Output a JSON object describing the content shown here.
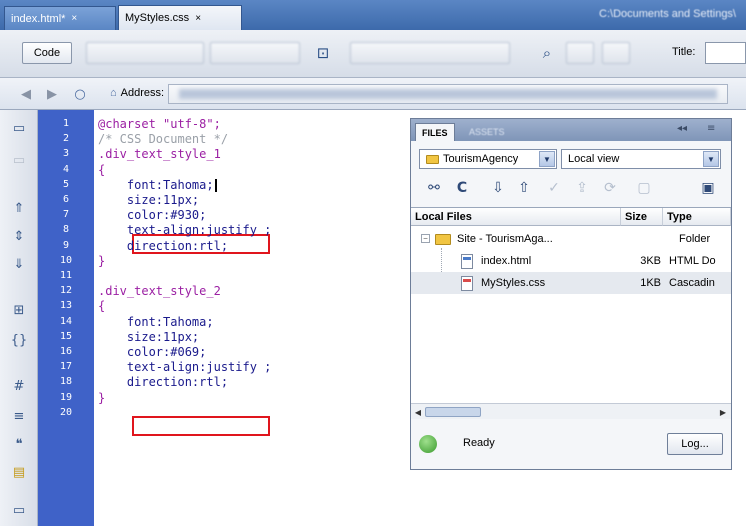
{
  "tabs": [
    {
      "label": "index.html*",
      "close": "×"
    },
    {
      "label": "MyStyles.css",
      "close": "×"
    }
  ],
  "window_path": "C:\\Documents and Settings\\",
  "toolbar": {
    "code_label": "Code",
    "title_label": "Title:"
  },
  "address": {
    "label": "Address:"
  },
  "code": {
    "line_numbers": [
      "1",
      "2",
      "3",
      "4",
      "5",
      "6",
      "7",
      "8",
      "9",
      "10",
      "11",
      "12",
      "13",
      "14",
      "15",
      "16",
      "17",
      "18",
      "19",
      "20"
    ],
    "lines": [
      {
        "parts": [
          {
            "t": "@charset \"utf-8\";",
            "c": "purple"
          }
        ]
      },
      {
        "parts": [
          {
            "t": "/* CSS Document */",
            "c": "gray"
          }
        ]
      },
      {
        "parts": [
          {
            "t": ".div_text_style_1",
            "c": "purple"
          }
        ]
      },
      {
        "parts": [
          {
            "t": "{",
            "c": "purple"
          }
        ]
      },
      {
        "parts": [
          {
            "t": "    font:Tahoma;",
            "c": "navy"
          }
        ],
        "cursor": true
      },
      {
        "parts": [
          {
            "t": "    size:11px;",
            "c": "navy"
          }
        ]
      },
      {
        "parts": [
          {
            "t": "    color:#930;",
            "c": "navy"
          }
        ]
      },
      {
        "parts": [
          {
            "t": "    text-align:justify ;",
            "c": "navy"
          }
        ]
      },
      {
        "parts": [
          {
            "t": "    direction:rtl;",
            "c": "navy"
          }
        ]
      },
      {
        "parts": [
          {
            "t": "}",
            "c": "purple"
          }
        ]
      },
      {
        "parts": [
          {
            "t": "",
            "c": "black"
          }
        ]
      },
      {
        "parts": [
          {
            "t": ".div_text_style_2",
            "c": "purple"
          }
        ]
      },
      {
        "parts": [
          {
            "t": "{",
            "c": "purple"
          }
        ]
      },
      {
        "parts": [
          {
            "t": "    font:Tahoma;",
            "c": "navy"
          }
        ]
      },
      {
        "parts": [
          {
            "t": "    size:11px;",
            "c": "navy"
          }
        ]
      },
      {
        "parts": [
          {
            "t": "    color:#069;",
            "c": "navy"
          }
        ]
      },
      {
        "parts": [
          {
            "t": "    text-align:justify ;",
            "c": "navy"
          }
        ]
      },
      {
        "parts": [
          {
            "t": "    direction:rtl;",
            "c": "navy"
          }
        ]
      },
      {
        "parts": [
          {
            "t": "}",
            "c": "purple"
          }
        ]
      },
      {
        "parts": [
          {
            "t": "",
            "c": "black"
          }
        ]
      }
    ]
  },
  "files_panel": {
    "tab_files": "FILES",
    "tab_assets": "ASSETS",
    "site_select": "TourismAgency",
    "view_select": "Local view",
    "columns": {
      "name": "Local Files",
      "size": "Size",
      "type": "Type"
    },
    "rows": [
      {
        "name": "Site - TourismAga...",
        "size": "",
        "type": "Folder",
        "icon": "folder",
        "selected": false
      },
      {
        "name": "index.html",
        "size": "3KB",
        "type": "HTML Do",
        "icon": "html",
        "selected": false
      },
      {
        "name": "MyStyles.css",
        "size": "1KB",
        "type": "Cascadin",
        "icon": "css",
        "selected": true
      }
    ],
    "status": "Ready",
    "log_button": "Log..."
  },
  "colors": {
    "gutter": "#3f62c8",
    "highlight_box": "#e0151d",
    "selector": "#9b1fa3",
    "property": "#1a1a8c",
    "comment": "#9aa0a8"
  }
}
